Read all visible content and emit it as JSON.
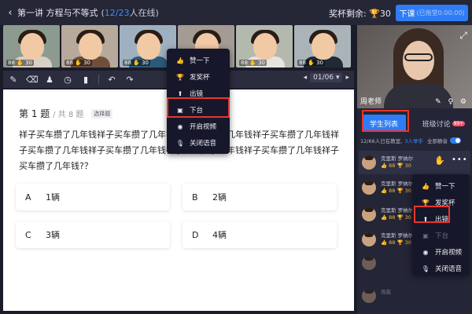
{
  "header": {
    "back_icon": "chevron-left-icon",
    "lesson_title": "第一讲 方程与不等式",
    "online_prefix": "(",
    "online_count": "12/23",
    "online_suffix": "人在线)",
    "trophy_label": "奖杯剩余:",
    "trophy_count": "30",
    "end_button": "下课",
    "end_button_time": "(已拖堂0:00:00)"
  },
  "students_strip": [
    {
      "stat": "88 ✋ 30",
      "bg": "#8d9a8f",
      "shirt": "#d8d0c6"
    },
    {
      "stat": "88 ✋ 30",
      "bg": "#b7a99b",
      "shirt": "#6f4e3a"
    },
    {
      "stat": "88 ✋ 30",
      "bg": "#9fb0c0",
      "shirt": "#2c5a7a"
    },
    {
      "stat": "88 ✋ 30",
      "bg": "#a49c94",
      "shirt": "#3d3d42"
    },
    {
      "stat": "88 ✋ 30",
      "bg": "#b4b9ae",
      "shirt": "#e7e4df"
    },
    {
      "stat": "88 ✋ 30",
      "bg": "#aab4b8",
      "shirt": "#1f2a36"
    }
  ],
  "teacher": {
    "name": "周老师",
    "expand_icon": "expand-icon",
    "controls": "✎ ♀ ⚙"
  },
  "toolbar": {
    "tools": [
      "pen-icon",
      "eraser-icon",
      "stamp-icon",
      "timer-icon",
      "chart-icon",
      "undo-icon",
      "redo-icon"
    ],
    "tool_glyphs": [
      "✎",
      "⌫",
      "♟",
      "◷",
      "▮",
      "↶",
      "↷"
    ],
    "page_prev": "◂",
    "page_value": "01/06 ▾",
    "page_next": "▸"
  },
  "question": {
    "number": "第 1 题",
    "total": "/ 共 8 题",
    "tag": "选择题",
    "text": "祥子买车攒了几年钱祥子买车攒了几年钱祥子买车攒了几年钱祥子买车攒了几年钱祥子买车攒了几年钱祥子买车攒了几年钱祥子买车攒了几年钱祥子买车攒了几年钱祥子买车攒了几年钱?？",
    "options": [
      {
        "letter": "A",
        "text": "1辆"
      },
      {
        "letter": "B",
        "text": "2辆"
      },
      {
        "letter": "C",
        "text": "3辆"
      },
      {
        "letter": "D",
        "text": "4辆"
      }
    ]
  },
  "menu_left": {
    "items": [
      {
        "icon": "thumbs-up-icon",
        "glyph": "👍",
        "label": "赞一下"
      },
      {
        "icon": "trophy-icon",
        "glyph": "🏆",
        "label": "发奖杯"
      },
      {
        "icon": "stage-icon",
        "glyph": "⬆",
        "label": "出镜"
      },
      {
        "icon": "stage-down-icon",
        "glyph": "▣",
        "label": "下台"
      },
      {
        "icon": "video-icon",
        "glyph": "◉",
        "label": "开启视频"
      },
      {
        "icon": "mic-icon",
        "glyph": "🎙",
        "label": "关闭语音"
      }
    ]
  },
  "right_panel": {
    "tab_students": "学生列表",
    "tab_discussion": "班级讨论",
    "tab_badge": "99+",
    "online_text": "12/66人已在教室,",
    "raise_text": "3人举手",
    "mute_text": "全部静音",
    "rows": [
      {
        "name": "克里斯 罗纳尔",
        "stat": "👍 88  🏆 30"
      },
      {
        "name": "克里斯 罗纳尔",
        "stat": "👍 88  🏆 30"
      },
      {
        "name": "克里斯 罗纳尔",
        "stat": "👍 88  🏆 30"
      },
      {
        "name": "克里斯 罗纳尔",
        "stat": "👍 88  🏆 30"
      },
      {
        "name": "",
        "stat": ""
      },
      {
        "name": "周鑫",
        "stat": ""
      }
    ],
    "more_icon": "more-icon",
    "hand_icon": "raise-hand-icon"
  },
  "menu_right": {
    "items": [
      {
        "icon": "thumbs-up-icon",
        "glyph": "👍",
        "label": "赞一下"
      },
      {
        "icon": "trophy-icon",
        "glyph": "🏆",
        "label": "发奖杯"
      },
      {
        "icon": "stage-icon",
        "glyph": "⬆",
        "label": "出镜"
      },
      {
        "icon": "stage-down-icon",
        "glyph": "▣",
        "label": "下台"
      },
      {
        "icon": "video-icon",
        "glyph": "◉",
        "label": "开启视频"
      },
      {
        "icon": "mic-icon",
        "glyph": "🎙",
        "label": "关闭语音"
      }
    ]
  },
  "colors": {
    "accent": "#2f7df6",
    "highlight": "#e8362d",
    "trophy": "#f5b83a"
  }
}
